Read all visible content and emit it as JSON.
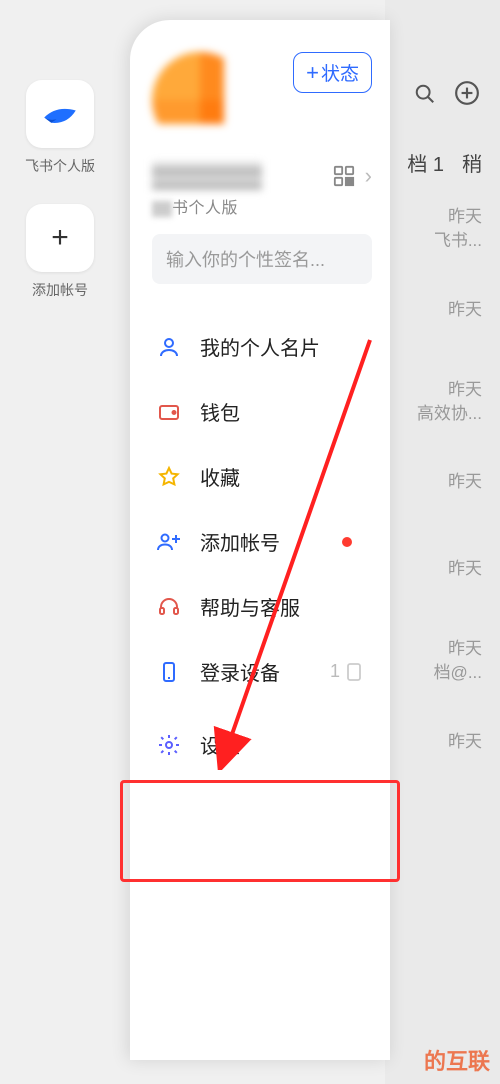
{
  "accounts": {
    "primary_label": "飞书个人版",
    "add_label": "添加帐号"
  },
  "bg": {
    "header_1": "档 1",
    "header_2": "稍",
    "items": [
      {
        "t1": "昨天",
        "t2": "飞书..."
      },
      {
        "t1": "昨天",
        "t2": ""
      },
      {
        "t1": "昨天",
        "t2": "高效协..."
      },
      {
        "t1": "昨天",
        "t2": ""
      },
      {
        "t1": "昨天",
        "t2": ""
      },
      {
        "t1": "昨天",
        "t2": "档@..."
      },
      {
        "t1": "昨天",
        "t2": ""
      }
    ],
    "watermark": "的互联"
  },
  "drawer": {
    "status_button": "状态",
    "sub_name": "书个人版",
    "signature_placeholder": "输入你的个性签名...",
    "menu": {
      "profile": "我的个人名片",
      "wallet": "钱包",
      "favorites": "收藏",
      "add_account": "添加帐号",
      "help": "帮助与客服",
      "devices": "登录设备",
      "device_count": "1",
      "settings": "设置"
    }
  }
}
